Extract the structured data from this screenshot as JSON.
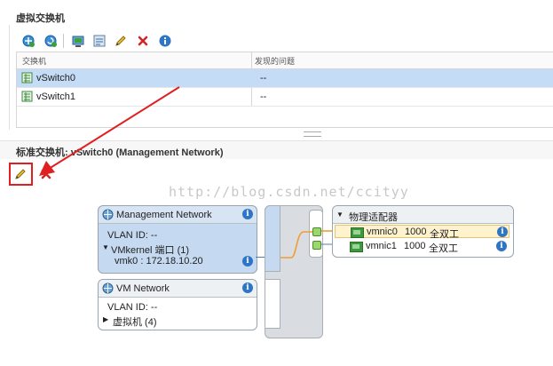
{
  "top_section": {
    "title": "虚拟交换机"
  },
  "toolbar": {
    "icons": [
      "add-network-icon",
      "refresh-network-icon",
      "host-icon",
      "manage-icon",
      "edit-icon",
      "delete-icon",
      "info-icon"
    ]
  },
  "switch_table": {
    "columns": [
      "交换机",
      "发现的问题"
    ],
    "rows": [
      {
        "name": "vSwitch0",
        "issues": "--",
        "selected": true
      },
      {
        "name": "vSwitch1",
        "issues": "--",
        "selected": false
      }
    ]
  },
  "detail_section": {
    "title": "标准交换机: vSwitch0 (Management Network)"
  },
  "watermark": "http://blog.csdn.net/ccityy",
  "port_groups": [
    {
      "name": "Management Network",
      "vlan": "VLAN ID: --",
      "vmkernel_label": "VMkernel 端口 (1)",
      "vmk": "vmk0 : 172.18.10.20"
    },
    {
      "name": "VM Network",
      "vlan": "VLAN ID: --",
      "vms_label": "虚拟机 (4)"
    }
  ],
  "physical_adapters": {
    "title": "物理适配器",
    "items": [
      {
        "name": "vmnic0",
        "speed": "1000",
        "duplex": "全双工",
        "highlighted": true
      },
      {
        "name": "vmnic1",
        "speed": "1000",
        "duplex": "全双工",
        "highlighted": false
      }
    ]
  },
  "colors": {
    "selection": "#c4dcf6",
    "portgroup_selected": "#c5d9f1",
    "link_orange": "#f29b33",
    "annotation_red": "#e02020",
    "nic_highlight": "#fff3cf"
  }
}
